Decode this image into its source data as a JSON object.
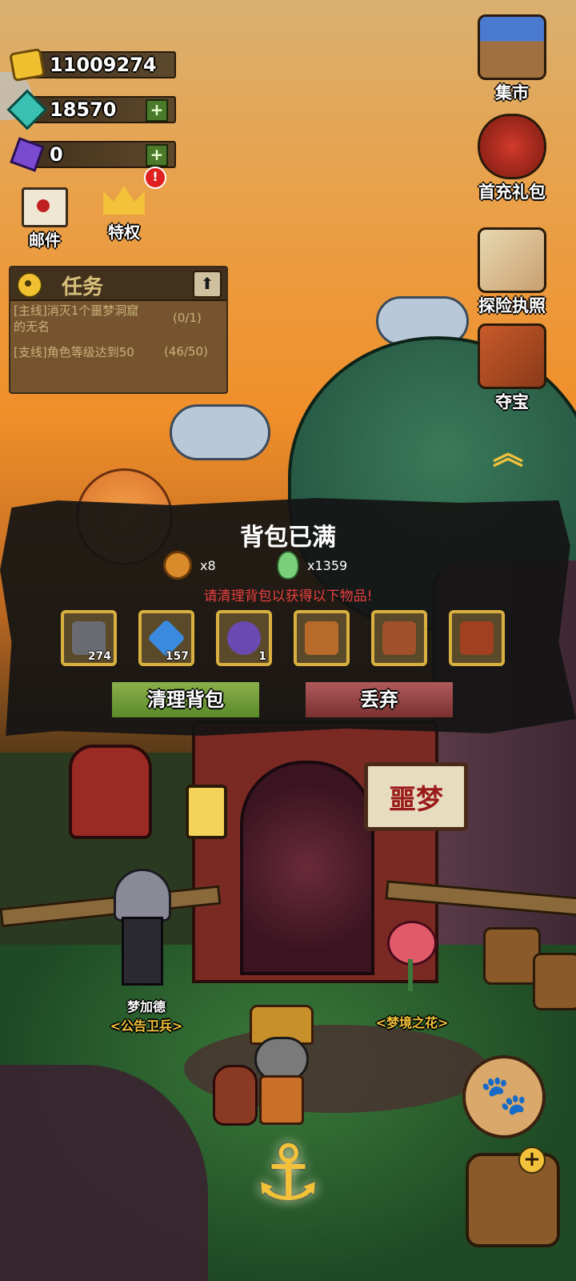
{
  "resources": {
    "gold": "11009274",
    "gems": "18570",
    "crystals": "0",
    "add_symbol": "+"
  },
  "left_menu": {
    "mail": "邮件",
    "privilege": "特权",
    "alert": "!"
  },
  "quest_panel": {
    "title": "任务",
    "items": [
      {
        "text": "[主线]消灭1个噩梦洞窟的无名",
        "progress": "(0/1)"
      },
      {
        "text": "[支线]角色等级达到50",
        "progress": "(46/50)"
      }
    ],
    "quest_line1": "[主线]消灭1个噩梦洞窟",
    "quest_line2": "的无名",
    "collapse_symbol": "⬆"
  },
  "right_menu": {
    "market": "集市",
    "first_charge": "首充礼包",
    "license": "探险执照",
    "treasure": "夺宝",
    "collapse_symbol": "︽"
  },
  "popup": {
    "title": "背包已满",
    "rewards": [
      {
        "icon": "coin-icon",
        "amount": "x8"
      },
      {
        "icon": "gourd-icon",
        "amount": "x1359"
      }
    ],
    "warning": "请清理背包以获得以下物品!",
    "items": [
      {
        "icon": "iron-ingot-icon",
        "count": "274",
        "color": "#6a6a72"
      },
      {
        "icon": "blue-crystal-icon",
        "count": "157",
        "color": "#3a8ae0"
      },
      {
        "icon": "purple-orb-icon",
        "count": "1",
        "color": "#6a4ab0"
      },
      {
        "icon": "brown-book-icon",
        "count": "",
        "color": "#b86a2a"
      },
      {
        "icon": "eye-book-icon",
        "count": "",
        "color": "#a0502a"
      },
      {
        "icon": "red-gem-book-icon",
        "count": "",
        "color": "#a04020"
      }
    ],
    "clean_button": "清理背包",
    "discard_button": "丢弃"
  },
  "scene": {
    "sign_text": "噩梦",
    "npc_guard": {
      "name": "梦加德",
      "title": "<公告卫兵>"
    },
    "npc_flower": {
      "title": "<梦境之花>"
    },
    "paw_symbol": "🐾",
    "anchor_symbol": "⚓",
    "bag_plus": "+"
  },
  "colors": {
    "accent_gold": "#f3c23a",
    "warning_red": "#e84040",
    "button_green": "#6e9a36",
    "button_red": "#944444"
  }
}
